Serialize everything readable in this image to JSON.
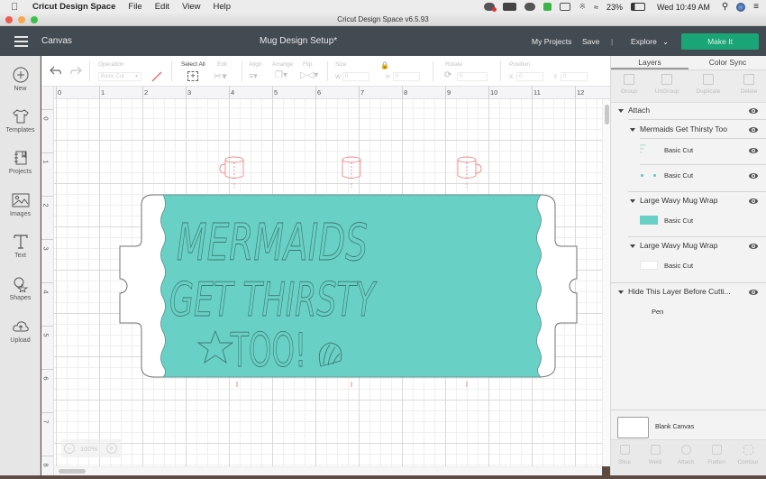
{
  "mac_menubar": {
    "app_name": "Cricut Design Space",
    "menus": [
      "File",
      "Edit",
      "View",
      "Help"
    ],
    "battery": "23%",
    "clock": "Wed 10:49 AM",
    "status_icons": [
      "cloud-alert-icon",
      "wd-drive-icon",
      "creative-cloud-icon",
      "green-c-icon",
      "airplay-icon",
      "bluetooth-icon",
      "wifi-icon",
      "battery-icon",
      "spotlight-search-icon",
      "siri-icon",
      "notification-center-icon"
    ]
  },
  "window": {
    "title": "Cricut Design Space  v6.5.93"
  },
  "appbar": {
    "canvas_label": "Canvas",
    "document_title": "Mug Design Setup*",
    "my_projects": "My Projects",
    "save": "Save",
    "separator": "|",
    "explore": "Explore",
    "make_it": "Make It",
    "accent_color": "#1aa577"
  },
  "sidebar": {
    "items": [
      {
        "label": "New",
        "icon": "plus-circle-icon"
      },
      {
        "label": "Templates",
        "icon": "tshirt-icon"
      },
      {
        "label": "Projects",
        "icon": "notebook-icon"
      },
      {
        "label": "Images",
        "icon": "image-icon"
      },
      {
        "label": "Text",
        "icon": "text-t-icon"
      },
      {
        "label": "Shapes",
        "icon": "shapes-icon"
      },
      {
        "label": "Upload",
        "icon": "cloud-upload-icon"
      }
    ]
  },
  "toolbar": {
    "operation_label": "Operation",
    "operation_value": "Basic Cut",
    "select_all": "Select All",
    "edit": "Edit",
    "align": "Align",
    "arrange": "Arrange",
    "flip": "Flip",
    "size": "Size",
    "w_label": "W",
    "h_label": "H",
    "w_value": "0",
    "h_value": "0",
    "rotate": "Rotate",
    "rotate_value": "0",
    "position": "Position",
    "x_label": "X",
    "y_label": "Y",
    "x_value": "0",
    "y_value": "0"
  },
  "rulers": {
    "top": [
      "0",
      "1",
      "2",
      "3",
      "4",
      "5",
      "6",
      "7",
      "8",
      "9",
      "10",
      "11",
      "12"
    ],
    "left": [
      "0",
      "1",
      "2",
      "3",
      "4",
      "5",
      "6",
      "7",
      "8"
    ]
  },
  "canvas": {
    "design_text_lines": [
      "MERMAIDS",
      "GET THIRSTY",
      "TOO!"
    ],
    "wrap_fill_color": "#68d0c5",
    "guide_color": "#f08a8a",
    "zoom_level": "100%",
    "zoom_out": "−",
    "zoom_in": "+"
  },
  "layers_panel": {
    "tabs": [
      "Layers",
      "Color Sync"
    ],
    "tools": [
      "Group",
      "UnGroup",
      "Duplicate",
      "Delete"
    ],
    "groups": [
      {
        "name": "Attach",
        "level": 0
      },
      {
        "name": "Mermaids Get Thirsty Too",
        "level": 1,
        "children": [
          {
            "label": "Basic Cut",
            "thumb": "text"
          },
          {
            "label": "Basic Cut",
            "thumb": "dots"
          }
        ]
      },
      {
        "name": "Large Wavy Mug Wrap",
        "level": 1,
        "children": [
          {
            "label": "Basic Cut",
            "thumb": "teal"
          }
        ]
      },
      {
        "name": "Large Wavy Mug Wrap",
        "level": 1,
        "children": [
          {
            "label": "Basic Cut",
            "thumb": "white"
          }
        ]
      },
      {
        "name": "Hide This Layer Before Cutti...",
        "level": 0,
        "children": [
          {
            "label": "Pen",
            "thumb": "none"
          }
        ]
      }
    ],
    "blank_canvas": "Blank Canvas",
    "bottom_tools": [
      "Slice",
      "Weld",
      "Attach",
      "Flatten",
      "Contour"
    ]
  }
}
